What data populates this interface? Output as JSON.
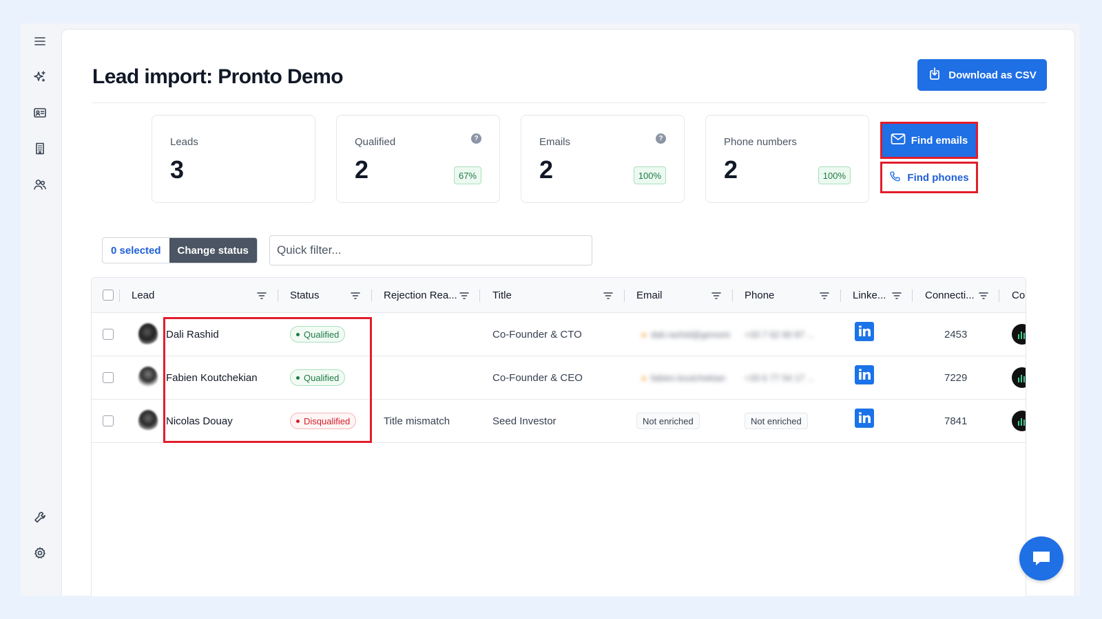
{
  "page": {
    "title": "Lead import: Pronto Demo"
  },
  "actions": {
    "download_csv": "Download as CSV",
    "find_emails": "Find emails",
    "find_phones": "Find phones"
  },
  "stats": [
    {
      "label": "Leads",
      "value": "3",
      "percent": "",
      "help": false
    },
    {
      "label": "Qualified",
      "value": "2",
      "percent": "67%",
      "help": true
    },
    {
      "label": "Emails",
      "value": "2",
      "percent": "100%",
      "help": true
    },
    {
      "label": "Phone numbers",
      "value": "2",
      "percent": "100%",
      "help": false
    }
  ],
  "toolbar": {
    "selected": "0 selected",
    "change_status": "Change status",
    "filter_placeholder": "Quick filter..."
  },
  "columns": [
    "Lead",
    "Status",
    "Rejection Rea...",
    "Title",
    "Email",
    "Phone",
    "Linke...",
    "Connecti...",
    "Co"
  ],
  "rows": [
    {
      "lead": "Dali Rashid",
      "status": "Qualified",
      "status_type": "qualified",
      "rejection": "",
      "title": "Co-Founder & CTO",
      "email": "dali.rashid@genomi",
      "phone": "+33 7 62 90 87 ...",
      "connections": "2453"
    },
    {
      "lead": "Fabien Koutchekian",
      "status": "Qualified",
      "status_type": "qualified",
      "rejection": "",
      "title": "Co-Founder & CEO",
      "email": "fabien.koutchekian",
      "phone": "+33 6 77 54 17 ...",
      "connections": "7229"
    },
    {
      "lead": "Nicolas Douay",
      "status": "Disqualified",
      "status_type": "disqualified",
      "rejection": "Title mismatch",
      "title": "Seed Investor",
      "email": "Not enriched",
      "phone": "Not enriched",
      "connections": "7841"
    }
  ],
  "linkedin_glyph": "in",
  "colors": {
    "primary": "#1f6fe5",
    "highlight": "#e11d2b",
    "qualified": "#1e7a44",
    "disqualified": "#d0202a"
  },
  "icons": [
    "menu-icon",
    "sparkles-icon",
    "contact-card-icon",
    "building-icon",
    "users-icon",
    "wrench-icon",
    "settings-icon",
    "download-icon",
    "mail-icon",
    "phone-icon",
    "help-icon",
    "filter-icon",
    "linkedin-icon",
    "chat-icon"
  ]
}
